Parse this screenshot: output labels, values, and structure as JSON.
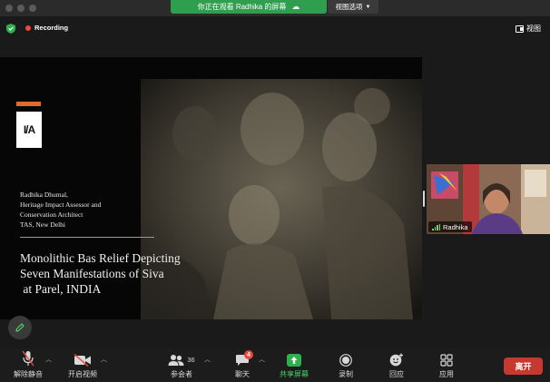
{
  "banner": {
    "text": "你正在观看 Radhika 的屏幕",
    "view_options": "视图选项"
  },
  "status": {
    "recording_label": "Recording",
    "view_label": "视图"
  },
  "slide": {
    "author_lines": [
      "Radhika Dhumal,",
      "Heritage Impact Assessor and",
      "Conservation Architect",
      "TAS, New Delhi"
    ],
    "title": "Monolithic Bas Relief Depicting\nSeven Manifestations of Siva\n at Parel, INDIA",
    "logo_text": "I/A"
  },
  "participant": {
    "name": "Radhika"
  },
  "toolbar": {
    "unmute": "解除静音",
    "start_video": "开启视频",
    "participants": "参会者",
    "participants_count": "36",
    "chat": "聊天",
    "chat_badge": "4",
    "share_screen": "共享屏幕",
    "record": "录制",
    "reactions": "回应",
    "apps": "应用",
    "leave": "离开"
  },
  "colors": {
    "share_green": "#2f9e4f",
    "record_red": "#e84a3d",
    "leave_red": "#c7382f",
    "logo_orange": "#e06a2c"
  }
}
